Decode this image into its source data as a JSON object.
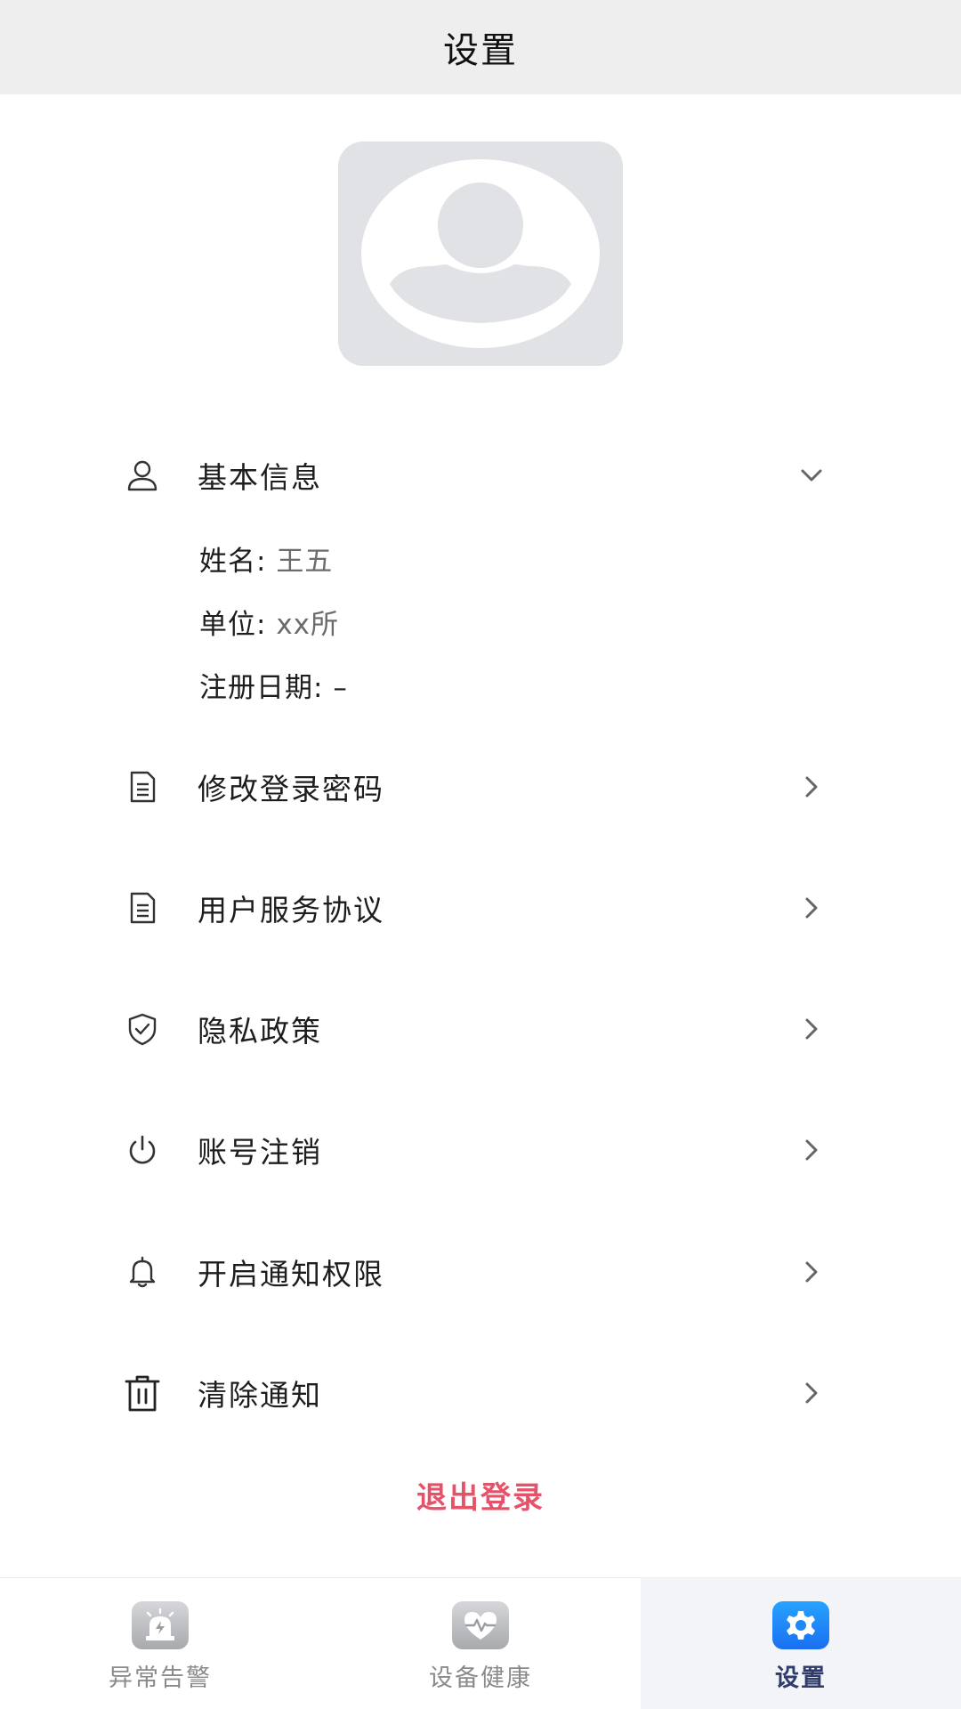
{
  "header": {
    "title": "设置"
  },
  "profile": {
    "section_label": "基本信息",
    "name_label": "姓名:",
    "name_value": "王五",
    "unit_label": "单位:",
    "unit_value": "xx所",
    "reg_label": "注册日期:",
    "reg_value": "–"
  },
  "menu": [
    {
      "label": "修改登录密码",
      "icon": "document-icon"
    },
    {
      "label": "用户服务协议",
      "icon": "document-icon"
    },
    {
      "label": "隐私政策",
      "icon": "shield-check-icon"
    },
    {
      "label": "账号注销",
      "icon": "power-icon"
    },
    {
      "label": "开启通知权限",
      "icon": "bell-icon"
    },
    {
      "label": "清除通知",
      "icon": "trash-icon"
    }
  ],
  "logout_label": "退出登录",
  "bottom_nav": [
    {
      "label": "异常告警",
      "icon": "alarm-light-icon",
      "active": false
    },
    {
      "label": "设备健康",
      "icon": "heart-pulse-icon",
      "active": false
    },
    {
      "label": "设置",
      "icon": "gear-icon",
      "active": true
    }
  ],
  "colors": {
    "header_bg": "#eeeeee",
    "logout_red": "#e5536a",
    "active_blue": "#1e88f5",
    "active_tab_bg": "#f3f4f7"
  }
}
